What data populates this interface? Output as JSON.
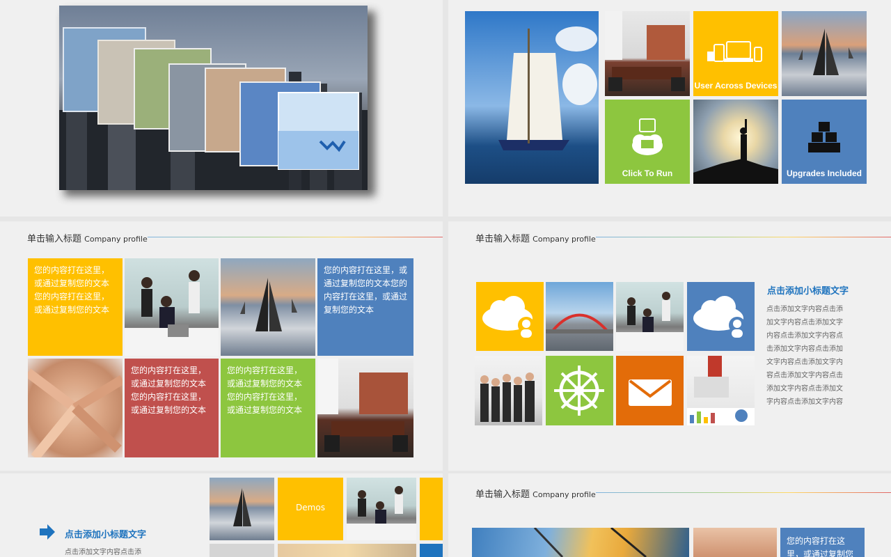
{
  "colors": {
    "yellow": "#ffc000",
    "blue": "#4f81bd",
    "green": "#8dc63f",
    "red": "#c0504d",
    "orange": "#e36c09",
    "accent_blue": "#1e73be"
  },
  "slide2": {
    "tile_devices_label": "User Across Devices",
    "tile_run_label": "Click To Run",
    "tile_upgrades_label": "Upgrades Included"
  },
  "slide3": {
    "header_cn": "单击输入标题",
    "header_en": "Company profile",
    "tile_yellow_text": "您的内容打在这里，或通过复制您的文本您的内容打在这里，或通过复制您的文本",
    "tile_blue_text": "您的内容打在这里，或通过复制您的文本您的内容打在这里，或通过复制您的文本",
    "tile_red_text": "您的内容打在这里，或通过复制您的文本您的内容打在这里，或通过复制您的文本",
    "tile_green_text": "您的内容打在这里，或通过复制您的文本您的内容打在这里，或通过复制您的文本"
  },
  "slide4": {
    "header_cn": "单击输入标题",
    "header_en": "Company profile",
    "subtitle": "点击添加小标题文字",
    "paragraph": "点击添加文字内容点击添加文字内容点击添加文字内容点击添加文字内容点击添加文字内容点击添加文字内容点击添加文字内容点击添加文字内容点击添加文字内容点击添加文字内容点击添加文字内容"
  },
  "slide5": {
    "subtitle": "点击添加小标题文字",
    "paragraph": "点击添加文字内容点击添",
    "tile_demos_label": "Demos"
  },
  "slide6": {
    "header_cn": "单击输入标题",
    "header_en": "Company profile",
    "tile_blue_text": "您的内容打在这里，或通过复制您的文"
  }
}
